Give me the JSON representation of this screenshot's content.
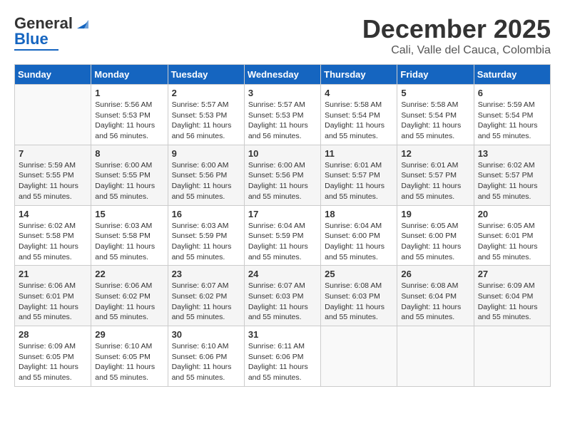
{
  "header": {
    "logo_line1": "General",
    "logo_line2": "Blue",
    "title": "December 2025",
    "subtitle": "Cali, Valle del Cauca, Colombia"
  },
  "calendar": {
    "days_of_week": [
      "Sunday",
      "Monday",
      "Tuesday",
      "Wednesday",
      "Thursday",
      "Friday",
      "Saturday"
    ],
    "weeks": [
      {
        "days": [
          {
            "num": "",
            "info": ""
          },
          {
            "num": "1",
            "info": "Sunrise: 5:56 AM\nSunset: 5:53 PM\nDaylight: 11 hours\nand 56 minutes."
          },
          {
            "num": "2",
            "info": "Sunrise: 5:57 AM\nSunset: 5:53 PM\nDaylight: 11 hours\nand 56 minutes."
          },
          {
            "num": "3",
            "info": "Sunrise: 5:57 AM\nSunset: 5:53 PM\nDaylight: 11 hours\nand 56 minutes."
          },
          {
            "num": "4",
            "info": "Sunrise: 5:58 AM\nSunset: 5:54 PM\nDaylight: 11 hours\nand 55 minutes."
          },
          {
            "num": "5",
            "info": "Sunrise: 5:58 AM\nSunset: 5:54 PM\nDaylight: 11 hours\nand 55 minutes."
          },
          {
            "num": "6",
            "info": "Sunrise: 5:59 AM\nSunset: 5:54 PM\nDaylight: 11 hours\nand 55 minutes."
          }
        ]
      },
      {
        "days": [
          {
            "num": "7",
            "info": "Sunrise: 5:59 AM\nSunset: 5:55 PM\nDaylight: 11 hours\nand 55 minutes."
          },
          {
            "num": "8",
            "info": "Sunrise: 6:00 AM\nSunset: 5:55 PM\nDaylight: 11 hours\nand 55 minutes."
          },
          {
            "num": "9",
            "info": "Sunrise: 6:00 AM\nSunset: 5:56 PM\nDaylight: 11 hours\nand 55 minutes."
          },
          {
            "num": "10",
            "info": "Sunrise: 6:00 AM\nSunset: 5:56 PM\nDaylight: 11 hours\nand 55 minutes."
          },
          {
            "num": "11",
            "info": "Sunrise: 6:01 AM\nSunset: 5:57 PM\nDaylight: 11 hours\nand 55 minutes."
          },
          {
            "num": "12",
            "info": "Sunrise: 6:01 AM\nSunset: 5:57 PM\nDaylight: 11 hours\nand 55 minutes."
          },
          {
            "num": "13",
            "info": "Sunrise: 6:02 AM\nSunset: 5:57 PM\nDaylight: 11 hours\nand 55 minutes."
          }
        ]
      },
      {
        "days": [
          {
            "num": "14",
            "info": "Sunrise: 6:02 AM\nSunset: 5:58 PM\nDaylight: 11 hours\nand 55 minutes."
          },
          {
            "num": "15",
            "info": "Sunrise: 6:03 AM\nSunset: 5:58 PM\nDaylight: 11 hours\nand 55 minutes."
          },
          {
            "num": "16",
            "info": "Sunrise: 6:03 AM\nSunset: 5:59 PM\nDaylight: 11 hours\nand 55 minutes."
          },
          {
            "num": "17",
            "info": "Sunrise: 6:04 AM\nSunset: 5:59 PM\nDaylight: 11 hours\nand 55 minutes."
          },
          {
            "num": "18",
            "info": "Sunrise: 6:04 AM\nSunset: 6:00 PM\nDaylight: 11 hours\nand 55 minutes."
          },
          {
            "num": "19",
            "info": "Sunrise: 6:05 AM\nSunset: 6:00 PM\nDaylight: 11 hours\nand 55 minutes."
          },
          {
            "num": "20",
            "info": "Sunrise: 6:05 AM\nSunset: 6:01 PM\nDaylight: 11 hours\nand 55 minutes."
          }
        ]
      },
      {
        "days": [
          {
            "num": "21",
            "info": "Sunrise: 6:06 AM\nSunset: 6:01 PM\nDaylight: 11 hours\nand 55 minutes."
          },
          {
            "num": "22",
            "info": "Sunrise: 6:06 AM\nSunset: 6:02 PM\nDaylight: 11 hours\nand 55 minutes."
          },
          {
            "num": "23",
            "info": "Sunrise: 6:07 AM\nSunset: 6:02 PM\nDaylight: 11 hours\nand 55 minutes."
          },
          {
            "num": "24",
            "info": "Sunrise: 6:07 AM\nSunset: 6:03 PM\nDaylight: 11 hours\nand 55 minutes."
          },
          {
            "num": "25",
            "info": "Sunrise: 6:08 AM\nSunset: 6:03 PM\nDaylight: 11 hours\nand 55 minutes."
          },
          {
            "num": "26",
            "info": "Sunrise: 6:08 AM\nSunset: 6:04 PM\nDaylight: 11 hours\nand 55 minutes."
          },
          {
            "num": "27",
            "info": "Sunrise: 6:09 AM\nSunset: 6:04 PM\nDaylight: 11 hours\nand 55 minutes."
          }
        ]
      },
      {
        "days": [
          {
            "num": "28",
            "info": "Sunrise: 6:09 AM\nSunset: 6:05 PM\nDaylight: 11 hours\nand 55 minutes."
          },
          {
            "num": "29",
            "info": "Sunrise: 6:10 AM\nSunset: 6:05 PM\nDaylight: 11 hours\nand 55 minutes."
          },
          {
            "num": "30",
            "info": "Sunrise: 6:10 AM\nSunset: 6:06 PM\nDaylight: 11 hours\nand 55 minutes."
          },
          {
            "num": "31",
            "info": "Sunrise: 6:11 AM\nSunset: 6:06 PM\nDaylight: 11 hours\nand 55 minutes."
          },
          {
            "num": "",
            "info": ""
          },
          {
            "num": "",
            "info": ""
          },
          {
            "num": "",
            "info": ""
          }
        ]
      }
    ]
  }
}
